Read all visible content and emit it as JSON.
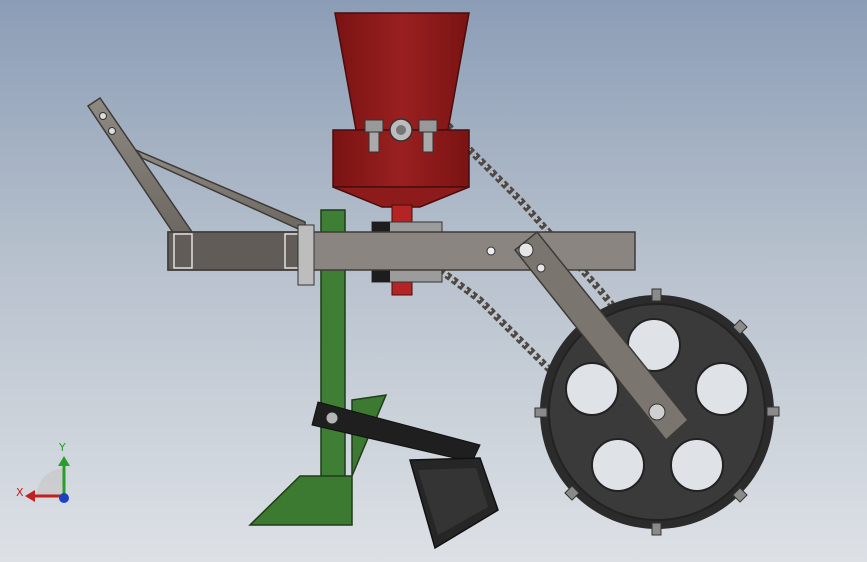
{
  "viewport": {
    "background_top": "#8b9db6",
    "background_bottom": "#dde1e6"
  },
  "model": {
    "parts": [
      "hopper",
      "hopper-base",
      "seed-tube",
      "frame-beam",
      "hitch-arm",
      "hitch-brace",
      "roller-chain",
      "press-wheel",
      "wheel-arm",
      "shank",
      "furrow-opener-shoe",
      "closing-arm",
      "closing-plate"
    ],
    "colors": {
      "hopper": "#8b1a1a",
      "frame": "#7b7570",
      "shank": "#3d7a32",
      "wheel": "#3a3a3a",
      "closing": "#262626"
    }
  },
  "triad": {
    "x_label": "X",
    "y_label": "Y",
    "x_color": "#c21f1f",
    "y_color": "#2a9d2a",
    "z_color": "#1f3fc2"
  }
}
